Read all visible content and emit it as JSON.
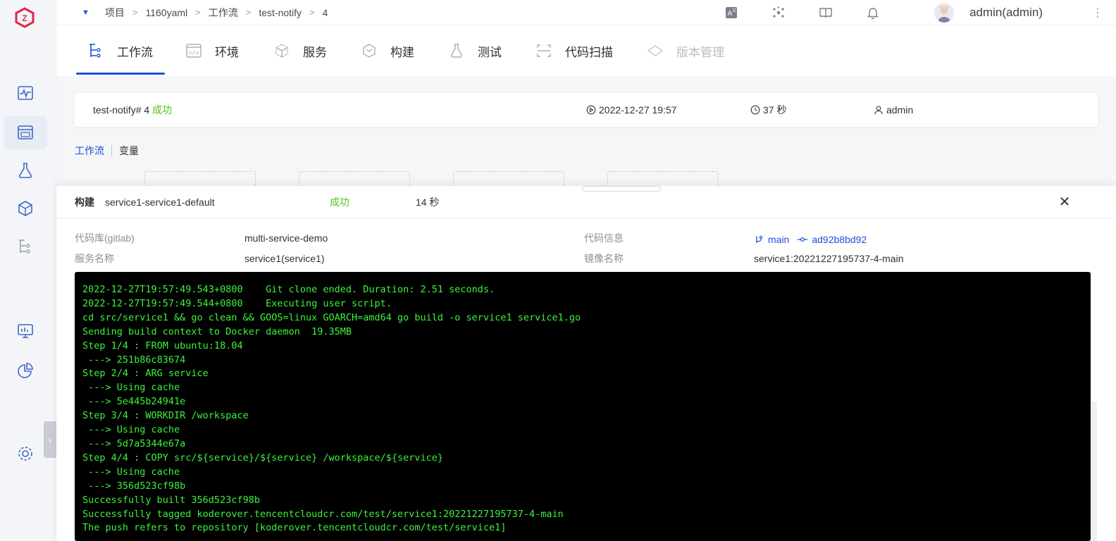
{
  "breadcrumb": {
    "items": [
      "项目",
      "1160yaml",
      "工作流",
      "test-notify",
      "4"
    ],
    "separator": ">"
  },
  "header": {
    "user": "admin(admin)"
  },
  "tabs": [
    {
      "label": "工作流",
      "icon": "workflow-icon",
      "active": true
    },
    {
      "label": "环境",
      "icon": "code-env-icon"
    },
    {
      "label": "服务",
      "icon": "service-cube-icon"
    },
    {
      "label": "构建",
      "icon": "build-hex-icon"
    },
    {
      "label": "测试",
      "icon": "flask-icon"
    },
    {
      "label": "代码扫描",
      "icon": "scan-icon"
    },
    {
      "label": "版本管理",
      "icon": "version-icon",
      "disabled": true
    }
  ],
  "run": {
    "name": "test-notify# 4",
    "status": "成功",
    "time": "2022-12-27 19:57",
    "duration": "37 秒",
    "user": "admin"
  },
  "subtabs": [
    "工作流",
    "变量"
  ],
  "drawer": {
    "type_label": "构建",
    "job_name": "service1-service1-default",
    "status": "成功",
    "duration": "14 秒",
    "repo_label": "代码库(gitlab)",
    "repo_value": "multi-service-demo",
    "service_label": "服务名称",
    "service_value": "service1(service1)",
    "code_info_label": "代码信息",
    "branch": "main",
    "commit": "ad92b8bd92",
    "image_label": "镜像名称",
    "image_value": "service1:20221227195737-4-main"
  },
  "log_lines": [
    "2022-12-27T19:57:49.543+0800    Git clone ended. Duration: 2.51 seconds.",
    "2022-12-27T19:57:49.544+0800    Executing user script.",
    "cd src/service1 && go clean && GOOS=linux GOARCH=amd64 go build -o service1 service1.go",
    "Sending build context to Docker daemon  19.35MB",
    "Step 1/4 : FROM ubuntu:18.04",
    " ---> 251b86c83674",
    "Step 2/4 : ARG service",
    " ---> Using cache",
    " ---> 5e445b24941e",
    "Step 3/4 : WORKDIR /workspace",
    " ---> Using cache",
    " ---> 5d7a5344e67a",
    "Step 4/4 : COPY src/${service}/${service} /workspace/${service}",
    " ---> Using cache",
    " ---> 356d523cf98b",
    "Successfully built 356d523cf98b",
    "Successfully tagged koderover.tencentcloudcr.com/test/service1:20221227195737-4-main",
    "The push refers to repository [koderover.tencentcloudcr.com/test/service1]"
  ],
  "colors": {
    "accent": "#1c52d6",
    "success": "#52c41a",
    "terminal_bg": "#000000",
    "terminal_fg": "#3df23d",
    "logo": "#e0274b"
  }
}
